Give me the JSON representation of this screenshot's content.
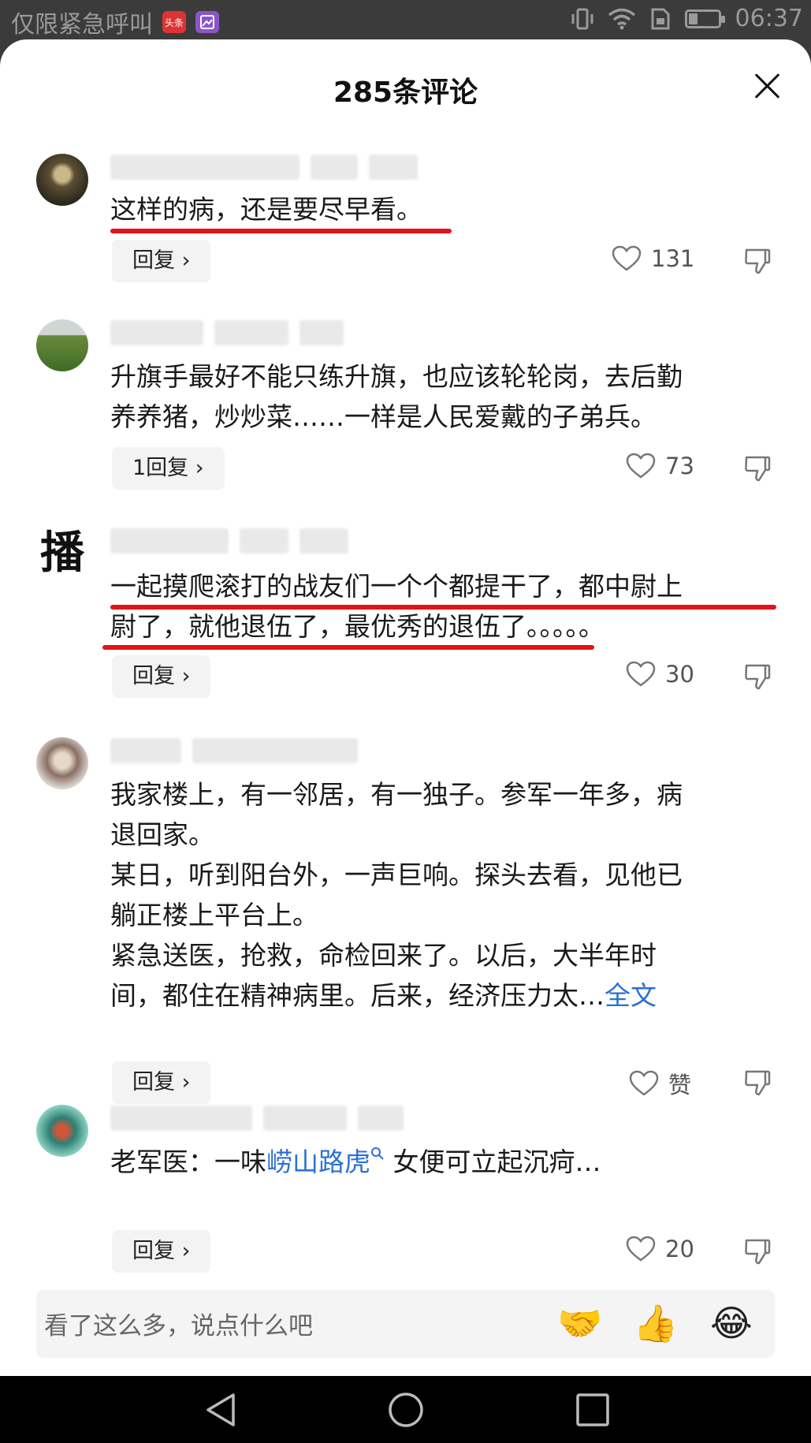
{
  "status_bar": {
    "carrier_text": "仅限紧急呼叫",
    "app_badge_1": "头条",
    "time": "06:37",
    "battery_level": 0.3
  },
  "sheet": {
    "title": "285条评论",
    "comments": [
      {
        "text": "这样的病，还是要尽早看。",
        "reply_label": "回复 ›",
        "likes": "131"
      },
      {
        "text": "升旗手最好不能只练升旗，也应该轮轮岗，去后勤\n养养猪，炒炒菜……一样是人民爱戴的子弟兵。",
        "reply_label": "1回复 ›",
        "likes": "73"
      },
      {
        "avatar_char": "播",
        "text": "一起摸爬滚打的战友们一个个都提干了，都中尉上\n尉了，就他退伍了，最优秀的退伍了。。。。。",
        "reply_label": "回复 ›",
        "likes": "30"
      },
      {
        "text": "我家楼上，有一邻居，有一独子。参军一年多，病\n退回家。\n某日，听到阳台外，一声巨响。探头去看，见他已\n躺正楼上平台上。\n紧急送医，抢救，命检回来了。以后，大半年时\n间，都住在精神病里。后来，经济压力太…",
        "more_label": "全文",
        "reply_label": "回复 ›",
        "likes": "赞"
      },
      {
        "text_before": "老军医：一味",
        "tag": "崂山路虎",
        "tag_icon": "search-icon",
        "text_after": " 女便可立起沉疴…",
        "reply_label": "回复 ›",
        "likes": "20"
      }
    ]
  },
  "input_bar": {
    "placeholder": "看了这么多，说点什么吧",
    "emojis": [
      "🤝",
      "👍",
      "😂"
    ]
  },
  "colors": {
    "underline": "#e1131b",
    "link": "#2b6fd6"
  }
}
